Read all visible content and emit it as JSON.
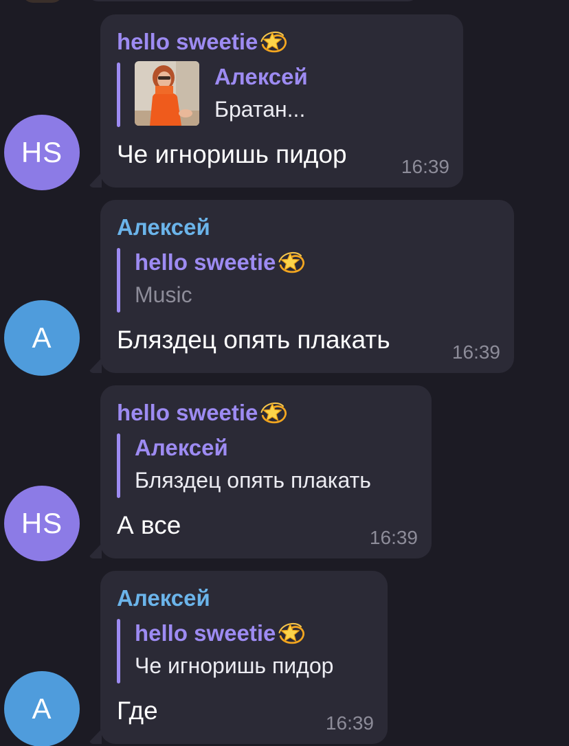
{
  "colors": {
    "background": "#1c1b24",
    "bubble": "#2b2a36",
    "name_purple": "#9d8bf2",
    "name_blue": "#6bb4ea",
    "avatar_hs": "#8c7be6",
    "avatar_a": "#4f9cdc",
    "time": "#8d8c99"
  },
  "messages": [
    {
      "avatar_initials": "HS",
      "sender": "hello sweetie",
      "sender_emoji": "dizzy-star-emoji",
      "reply": {
        "name": "Алексей",
        "text": "Братан...",
        "has_thumbnail": true
      },
      "text": "Че игноришь пидор",
      "time": "16:39"
    },
    {
      "avatar_initials": "A",
      "sender": "Алексей",
      "reply": {
        "name": "hello sweetie",
        "name_emoji": "dizzy-star-emoji",
        "text": "Music"
      },
      "text": "Бляздец опять плакать",
      "time": "16:39"
    },
    {
      "avatar_initials": "HS",
      "sender": "hello sweetie",
      "sender_emoji": "dizzy-star-emoji",
      "reply": {
        "name": "Алексей",
        "text": "Бляздец опять плакать"
      },
      "text": "А все",
      "time": "16:39"
    },
    {
      "avatar_initials": "A",
      "sender": "Алексей",
      "reply": {
        "name": "hello sweetie",
        "name_emoji": "dizzy-star-emoji",
        "text": "Че игноришь пидор"
      },
      "text": "Где",
      "time": "16:39"
    }
  ]
}
